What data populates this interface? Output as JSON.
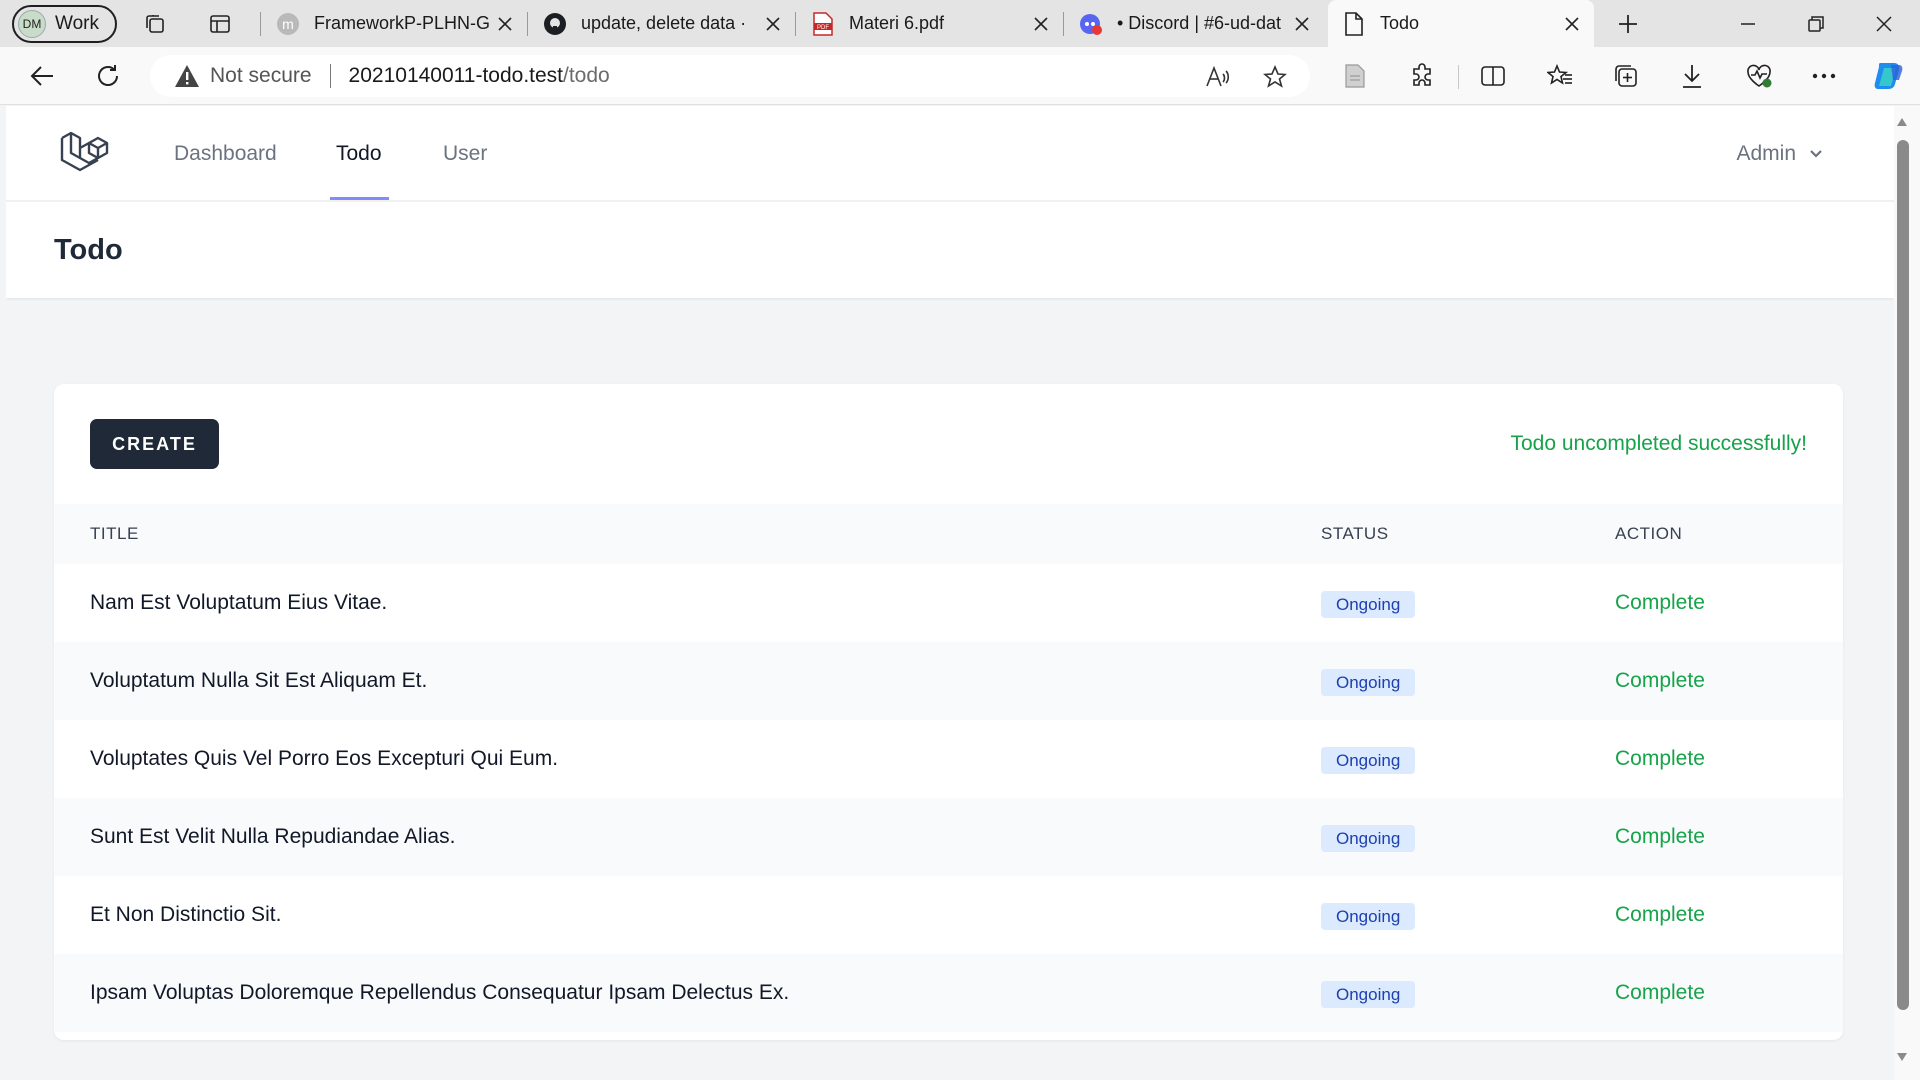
{
  "browser": {
    "profile": {
      "initials": "DM",
      "name": "Work"
    },
    "tabs": [
      {
        "title": "FrameworkP-PLHN-G",
        "icon": "m-icon"
      },
      {
        "title": "update, delete data ·",
        "icon": "github-icon"
      },
      {
        "title": "Materi 6.pdf",
        "icon": "pdf-icon"
      },
      {
        "title": "• Discord | #6-ud-dat",
        "icon": "discord-icon"
      },
      {
        "title": "Todo",
        "icon": "page-icon",
        "active": true
      }
    ],
    "address": {
      "security_label": "Not secure",
      "url_host": "20210140011-todo.test",
      "url_path": "/todo"
    }
  },
  "app": {
    "nav": {
      "links": [
        {
          "label": "Dashboard",
          "active": false
        },
        {
          "label": "Todo",
          "active": true
        },
        {
          "label": "User",
          "active": false
        }
      ],
      "user_label": "Admin"
    },
    "page_title": "Todo",
    "create_label": "CREATE",
    "flash_message": "Todo uncompleted successfully!",
    "table": {
      "headers": [
        "TITLE",
        "STATUS",
        "ACTION"
      ],
      "rows": [
        {
          "title": "Nam Est Voluptatum Eius Vitae.",
          "status": "Ongoing",
          "action": "Complete"
        },
        {
          "title": "Voluptatum Nulla Sit Est Aliquam Et.",
          "status": "Ongoing",
          "action": "Complete"
        },
        {
          "title": "Voluptates Quis Vel Porro Eos Excepturi Qui Eum.",
          "status": "Ongoing",
          "action": "Complete"
        },
        {
          "title": "Sunt Est Velit Nulla Repudiandae Alias.",
          "status": "Ongoing",
          "action": "Complete"
        },
        {
          "title": "Et Non Distinctio Sit.",
          "status": "Ongoing",
          "action": "Complete"
        },
        {
          "title": "Ipsam Voluptas Doloremque Repellendus Consequatur Ipsam Delectus Ex.",
          "status": "Ongoing",
          "action": "Complete"
        }
      ]
    }
  },
  "colors": {
    "primary_button": "#1f2937",
    "success_text": "#16a34a",
    "badge_bg": "#dbeafe",
    "badge_text": "#1e40af",
    "nav_active_underline": "#818cf8"
  }
}
